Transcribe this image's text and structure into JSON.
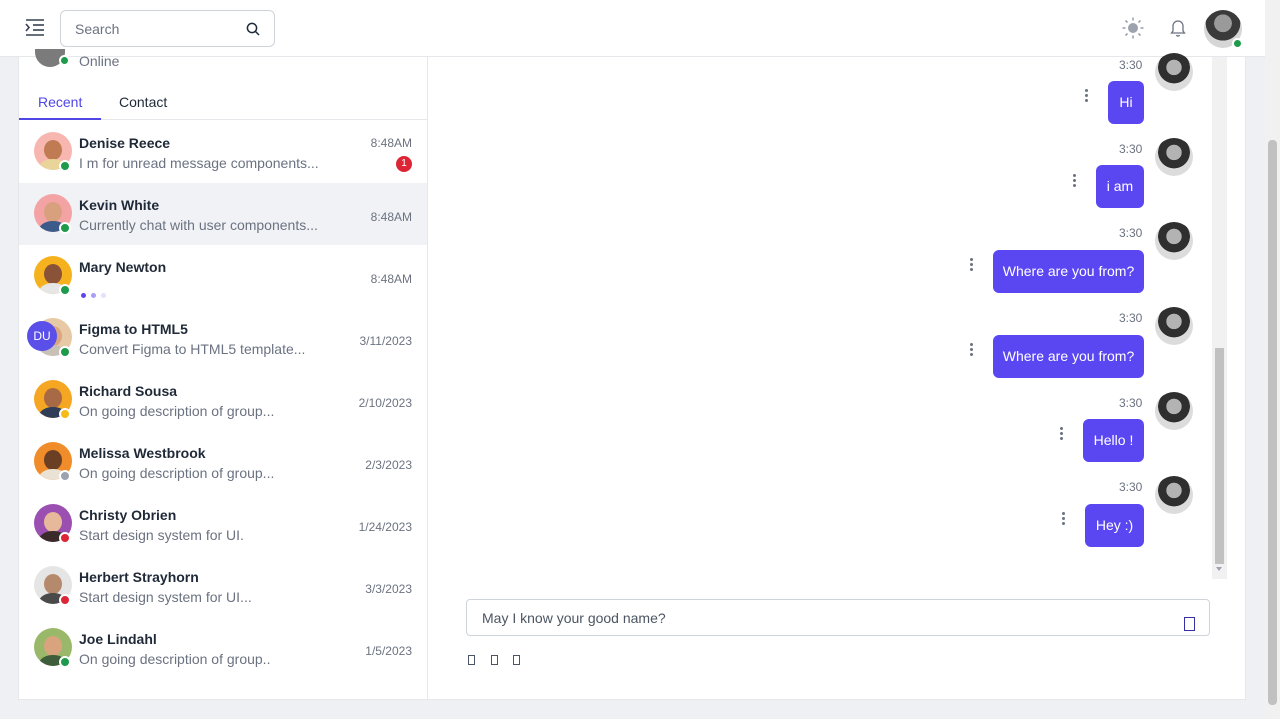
{
  "header": {
    "search_placeholder": "Search",
    "icons": [
      "menu-icon",
      "search-icon",
      "sun-icon",
      "bell-icon"
    ]
  },
  "profile": {
    "status": "Online",
    "status_color": "#1e9a4b"
  },
  "tabs": [
    {
      "label": "Recent",
      "active": true
    },
    {
      "label": "Contact",
      "active": false
    }
  ],
  "conversations": [
    {
      "name": "Denise Reece",
      "preview": "I m for unread message components...",
      "time": "8:48AM",
      "unread": "1",
      "status_color": "#1e9a4b"
    },
    {
      "name": "Kevin White",
      "preview": "Currently chat with user components...",
      "time": "8:48AM",
      "status_color": "#1e9a4b"
    },
    {
      "name": "Mary Newton",
      "preview": "",
      "time": "8:48AM",
      "typing": true,
      "status_color": "#1e9a4b"
    },
    {
      "name": "Figma to HTML5",
      "preview": "Convert Figma to HTML5 template...",
      "time": "3/11/2023",
      "group_badge": "DU",
      "status_color": "#1e9a4b"
    },
    {
      "name": "Richard Sousa",
      "preview": "On going description of group...",
      "time": "2/10/2023",
      "status_color": "#f5b918"
    },
    {
      "name": "Melissa Westbrook",
      "preview": "On going description of group...",
      "time": "2/3/2023",
      "status_color": "#9ca3af"
    },
    {
      "name": "Christy Obrien",
      "preview": "Start design system for UI.",
      "time": "1/24/2023",
      "status_color": "#dc2635"
    },
    {
      "name": "Herbert Strayhorn",
      "preview": "Start design system for UI...",
      "time": "3/3/2023",
      "status_color": "#dc2635"
    },
    {
      "name": "Joe Lindahl",
      "preview": "On going description of group..",
      "time": "1/5/2023",
      "status_color": "#1e9a4b"
    }
  ],
  "messages": [
    {
      "time": "3:30",
      "text": "Hi"
    },
    {
      "time": "3:30",
      "text": "i am"
    },
    {
      "time": "3:30",
      "text": "Where are you from?"
    },
    {
      "time": "3:30",
      "text": "Where are you from?"
    },
    {
      "time": "3:30",
      "text": "Hello !"
    },
    {
      "time": "3:30",
      "text": "Hey :)"
    }
  ],
  "composer": {
    "placeholder": "May I know your good name?"
  },
  "colors": {
    "accent": "#5b47f2",
    "tab_active": "#4f46e5",
    "unread": "#dc2635"
  }
}
